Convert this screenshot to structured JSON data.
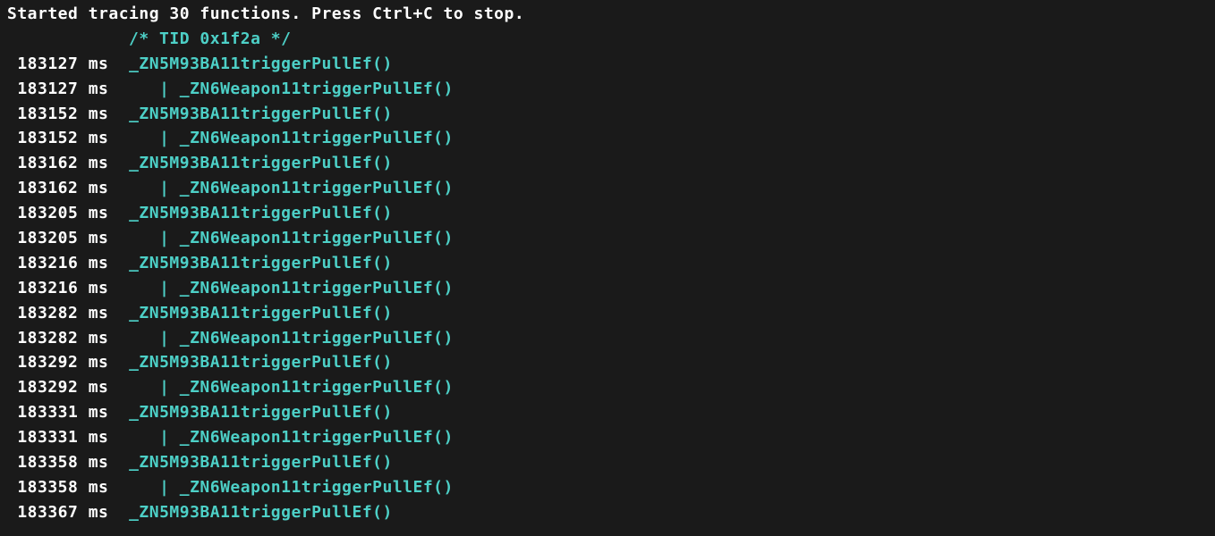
{
  "header": "Started tracing 30 functions. Press Ctrl+C to stop.",
  "tid_comment": "/* TID 0x1f2a */",
  "tid_indent": "            ",
  "ms_label": "ms",
  "outer_func": "_ZN5M93BA11triggerPullEf()",
  "inner_func": "_ZN6Weapon11triggerPullEf()",
  "outer_indent": "  ",
  "inner_indent": "     | ",
  "timestamp_pad": " ",
  "trace_entries": [
    {
      "ts": "183127",
      "type": "outer"
    },
    {
      "ts": "183127",
      "type": "inner"
    },
    {
      "ts": "183152",
      "type": "outer"
    },
    {
      "ts": "183152",
      "type": "inner"
    },
    {
      "ts": "183162",
      "type": "outer"
    },
    {
      "ts": "183162",
      "type": "inner"
    },
    {
      "ts": "183205",
      "type": "outer"
    },
    {
      "ts": "183205",
      "type": "inner"
    },
    {
      "ts": "183216",
      "type": "outer"
    },
    {
      "ts": "183216",
      "type": "inner"
    },
    {
      "ts": "183282",
      "type": "outer"
    },
    {
      "ts": "183282",
      "type": "inner"
    },
    {
      "ts": "183292",
      "type": "outer"
    },
    {
      "ts": "183292",
      "type": "inner"
    },
    {
      "ts": "183331",
      "type": "outer"
    },
    {
      "ts": "183331",
      "type": "inner"
    },
    {
      "ts": "183358",
      "type": "outer"
    },
    {
      "ts": "183358",
      "type": "inner"
    },
    {
      "ts": "183367",
      "type": "outer"
    }
  ]
}
